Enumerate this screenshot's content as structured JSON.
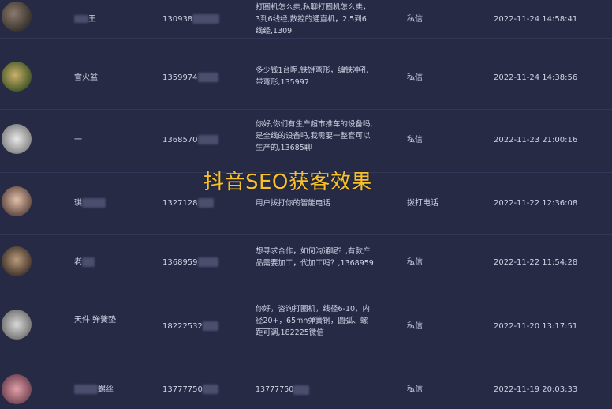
{
  "watermark": "抖音SEO获客效果",
  "rows": [
    {
      "name": "王",
      "phone": "130938",
      "message": "打圈机怎么卖,私聊打圈机怎么卖，3到6线经,数控的通直机，2.5到6线经,1309",
      "type": "私信",
      "time": "2022-11-24 14:58:41"
    },
    {
      "name": "雪火盆",
      "phone": "1359974",
      "message": "多少钱1台呢,铁饼弯形，编铁冲孔带弯形,135997",
      "type": "私信",
      "time": "2022-11-24 14:38:56"
    },
    {
      "name": "一",
      "phone": "1368570",
      "message": "你好,你们有生产超市推车的设备吗,是全线的设备吗,我需要一整套可以生产的,13685聊",
      "type": "私信",
      "time": "2022-11-23 21:00:16"
    },
    {
      "name": "琪",
      "phone": "1327128",
      "message": "用户拨打你的智能电话",
      "type": "拨打电话",
      "time": "2022-11-22 12:36:08"
    },
    {
      "name": "老",
      "phone": "1368959",
      "message": "想寻求合作，如何沟通呢？,有款产品需要加工，代加工吗？,1368959",
      "type": "私信",
      "time": "2022-11-22 11:54:28"
    },
    {
      "name": "天件 弹簧垫",
      "phone": "18222532",
      "message": "你好，咨询打圈机，线径6-10，内径20+，65mn弹簧钢，圆弧、螺距可调,182225微信",
      "type": "私信",
      "time": "2022-11-20 13:17:51"
    },
    {
      "name": "螺丝",
      "phone": "13777750",
      "message": "13777750",
      "type": "私信",
      "time": "2022-11-19 20:03:33"
    }
  ]
}
